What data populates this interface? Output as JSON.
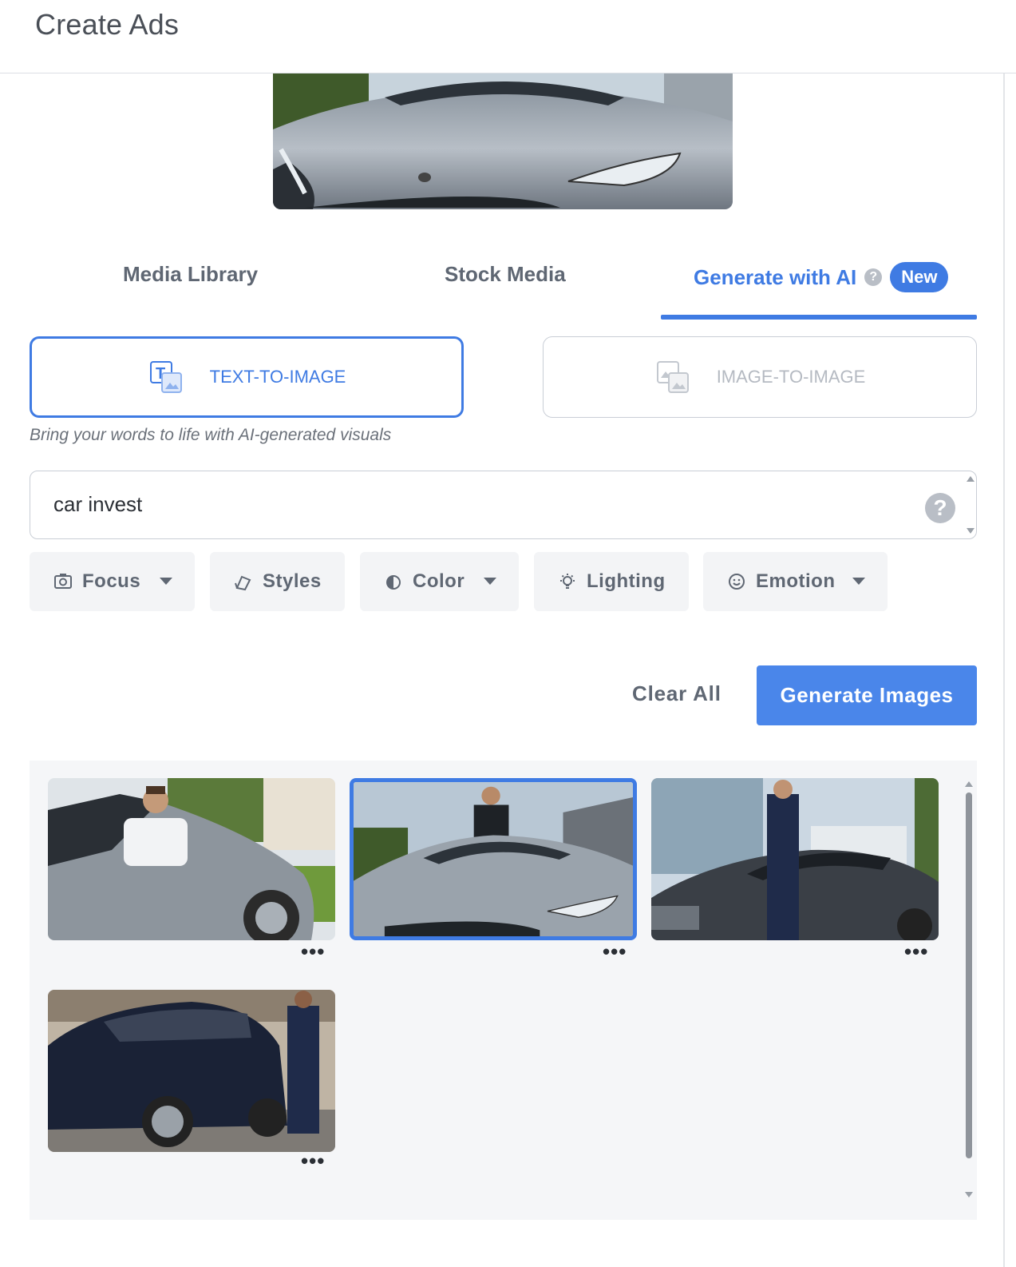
{
  "header": {
    "title": "Create Ads"
  },
  "tabs": [
    {
      "label": "Media Library",
      "active": false
    },
    {
      "label": "Stock Media",
      "active": false
    },
    {
      "label": "Generate with AI",
      "active": true,
      "badge": "New",
      "help_icon": "question-icon"
    }
  ],
  "modes": {
    "text_to_image": {
      "label": "TEXT-TO-IMAGE",
      "selected": true,
      "icon": "text-image-icon"
    },
    "image_to_image": {
      "label": "IMAGE-TO-IMAGE",
      "selected": false,
      "icon": "image-image-icon"
    }
  },
  "subtitle": "Bring your words to life with AI-generated visuals",
  "prompt": {
    "value": "car invest",
    "help_icon": "question-icon"
  },
  "filters": [
    {
      "label": "Focus",
      "icon": "camera-icon",
      "dropdown": true
    },
    {
      "label": "Styles",
      "icon": "brush-icon",
      "dropdown": false
    },
    {
      "label": "Color",
      "icon": "droplet-icon",
      "dropdown": true
    },
    {
      "label": "Lighting",
      "icon": "bulb-icon",
      "dropdown": false
    },
    {
      "label": "Emotion",
      "icon": "smile-icon",
      "dropdown": true
    }
  ],
  "actions": {
    "clear_label": "Clear All",
    "generate_label": "Generate Images"
  },
  "gallery": {
    "images": [
      {
        "subject": "man in white shirt seated in silver car",
        "selected": false,
        "menu": "•••"
      },
      {
        "subject": "man in suit behind silver sports car",
        "selected": true,
        "menu": "•••"
      },
      {
        "subject": "man in navy suit leaning on dark sedan",
        "selected": false,
        "menu": "•••"
      },
      {
        "subject": "man in navy suit walking by dark SUV",
        "selected": false,
        "menu": "•••"
      }
    ]
  },
  "colors": {
    "accent": "#3f7be3",
    "button": "#4a86ea",
    "muted": "#5f6773"
  }
}
